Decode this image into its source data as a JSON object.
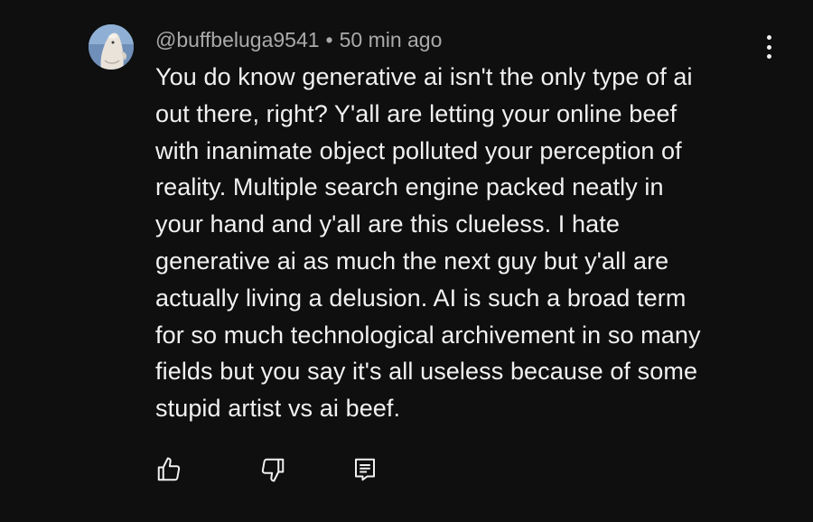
{
  "comment": {
    "author": "@buffbeluga9541",
    "separator": "•",
    "timestamp": "50 min ago",
    "text": "You do know generative ai isn't the only type of ai\nout there, right? Y'all are letting your online beef\nwith inanimate object polluted your perception of\nreality. Multiple search engine packed neatly in\nyour hand and y'all are this clueless. I hate\ngenerative ai as much the next guy but y'all are\nactually living a delusion. AI is such a broad term\nfor so much technological archivement in so many\nfields but you say it's all useless because of some\nstupid artist vs ai beef."
  },
  "actions": {
    "like_icon": "thumbs-up-icon",
    "dislike_icon": "thumbs-down-icon",
    "reply_icon": "reply-icon",
    "more_icon": "more-vertical-icon"
  },
  "colors": {
    "background": "#0f0f0f",
    "text": "#f1f1f1",
    "meta": "#aaaaaa"
  }
}
